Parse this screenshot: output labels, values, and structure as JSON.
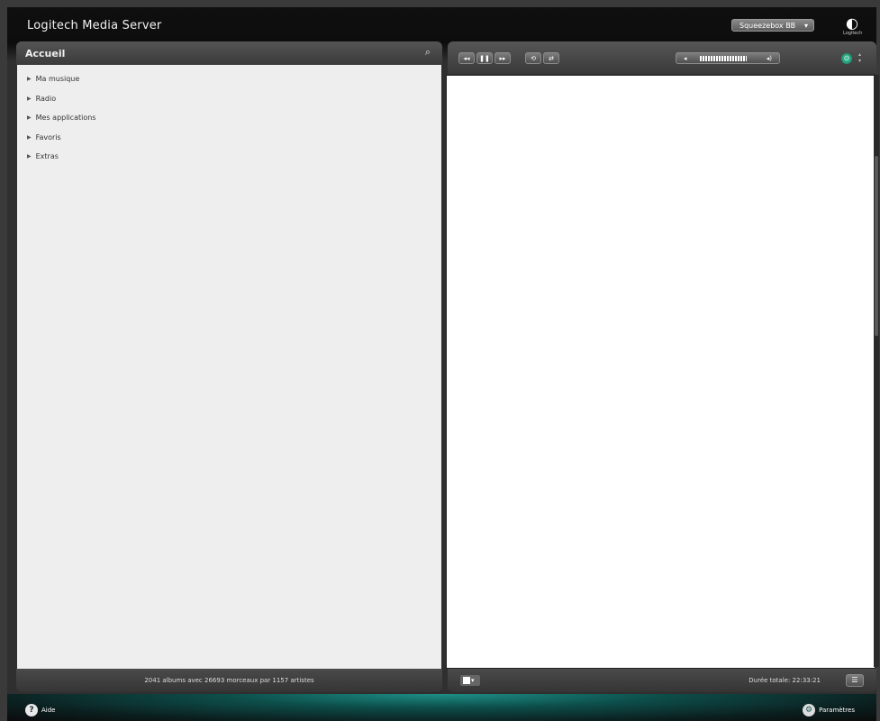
{
  "header": {
    "app_title": "Logitech Media Server",
    "player_name": "Squeezebox BB",
    "logo_text": "Logitech"
  },
  "left_panel": {
    "title": "Accueil",
    "menu": [
      {
        "label": "Ma musique"
      },
      {
        "label": "Radio"
      },
      {
        "label": "Mes applications"
      },
      {
        "label": "Favoris"
      },
      {
        "label": "Extras"
      }
    ],
    "footer_stats": "2041 albums avec 26693 morceaux par 1157 artistes"
  },
  "player_controls": {
    "prev": "◂◂",
    "pause": "❚❚",
    "next": "▸▸",
    "repeat": "⟲",
    "shuffle": "⇄",
    "vol_down": "◂",
    "vol_up": "◂)",
    "power": "⏻"
  },
  "right_panel": {
    "total_time": "Durée totale: 22:33:21"
  },
  "bottom_bar": {
    "help_label": "Aide",
    "settings_label": "Paramètres"
  },
  "icons": {
    "search": "search-icon",
    "power": "power-icon",
    "help": "help-icon",
    "settings": "gear-icon"
  },
  "colors": {
    "accent": "#1e8f87",
    "power": "#3fc9a0",
    "panel_bg": "#eeeeee"
  }
}
